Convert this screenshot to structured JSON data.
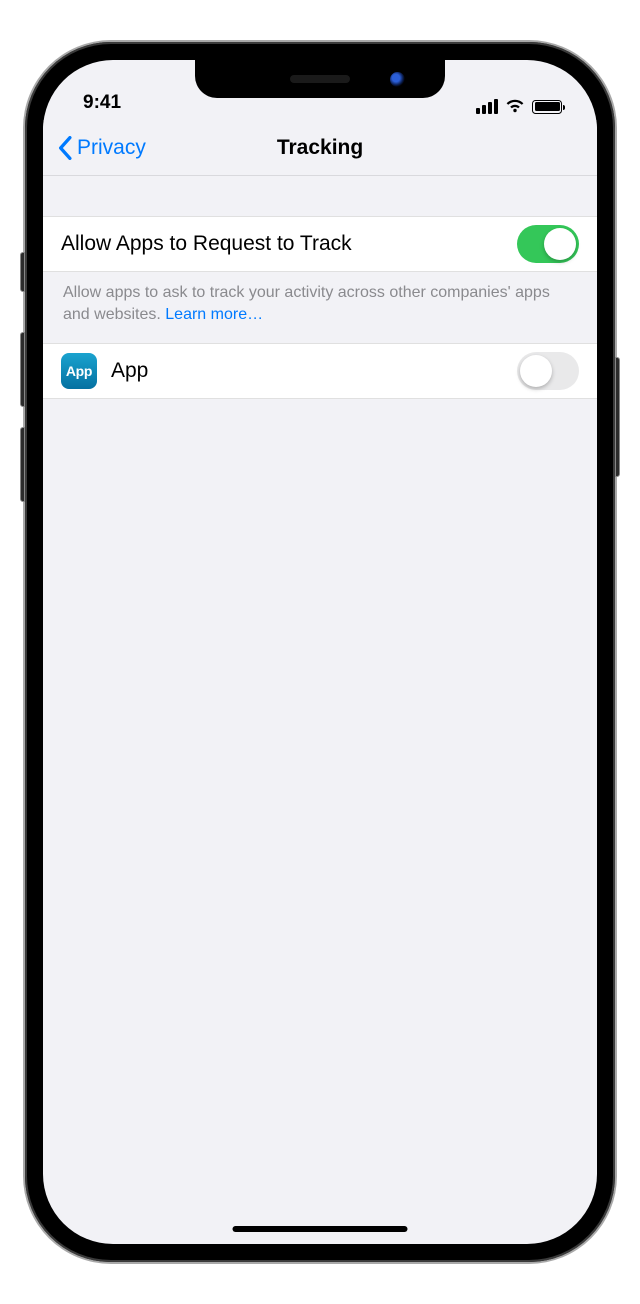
{
  "status": {
    "time": "9:41"
  },
  "nav": {
    "back_label": "Privacy",
    "title": "Tracking"
  },
  "main_toggle": {
    "label": "Allow Apps to Request to Track",
    "on": true
  },
  "footer": {
    "text": "Allow apps to ask to track your activity across other companies' apps and websites. ",
    "link": "Learn more…"
  },
  "apps": [
    {
      "name": "App",
      "icon_text": "App",
      "on": false
    }
  ]
}
